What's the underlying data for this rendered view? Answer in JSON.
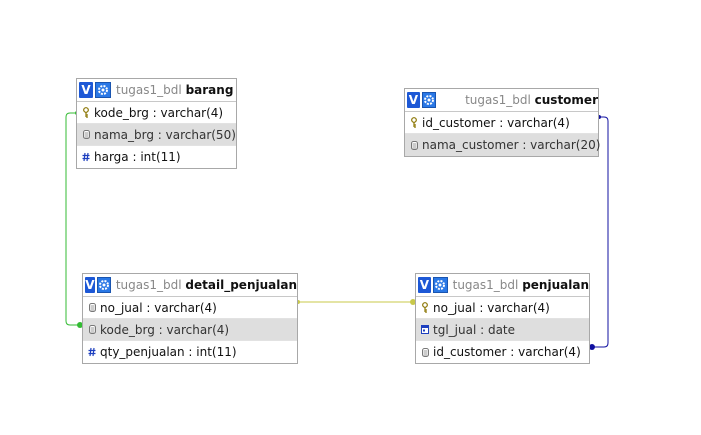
{
  "tables": [
    {
      "name": "barang",
      "db": "tugas1_bdl",
      "columns": [
        {
          "label": "kode_brg : varchar(4)",
          "icon": "key-icon"
        },
        {
          "label": "nama_brg : varchar(50)",
          "icon": "column-icon"
        },
        {
          "label": "harga : int(11)",
          "icon": "number-icon"
        }
      ]
    },
    {
      "name": "customer",
      "db": "tugas1_bdl",
      "columns": [
        {
          "label": "id_customer : varchar(4)",
          "icon": "key-icon"
        },
        {
          "label": "nama_customer : varchar(20)",
          "icon": "column-icon"
        }
      ]
    },
    {
      "name": "detail_penjualan",
      "db": "tugas1_bdl",
      "columns": [
        {
          "label": "no_jual : varchar(4)",
          "icon": "column-icon"
        },
        {
          "label": "kode_brg : varchar(4)",
          "icon": "column-icon"
        },
        {
          "label": "qty_penjualan : int(11)",
          "icon": "number-icon"
        }
      ]
    },
    {
      "name": "penjualan",
      "db": "tugas1_bdl",
      "columns": [
        {
          "label": "no_jual : varchar(4)",
          "icon": "key-icon"
        },
        {
          "label": "tgl_jual : date",
          "icon": "date-icon"
        },
        {
          "label": "id_customer : varchar(4)",
          "icon": "column-icon"
        }
      ]
    }
  ],
  "toggle_label": "V",
  "colors": {
    "relation_barang": "#33bb33",
    "relation_penjualan": "#c8c84a",
    "relation_customer": "#1010a0",
    "header_blue": "#1d58d6"
  }
}
